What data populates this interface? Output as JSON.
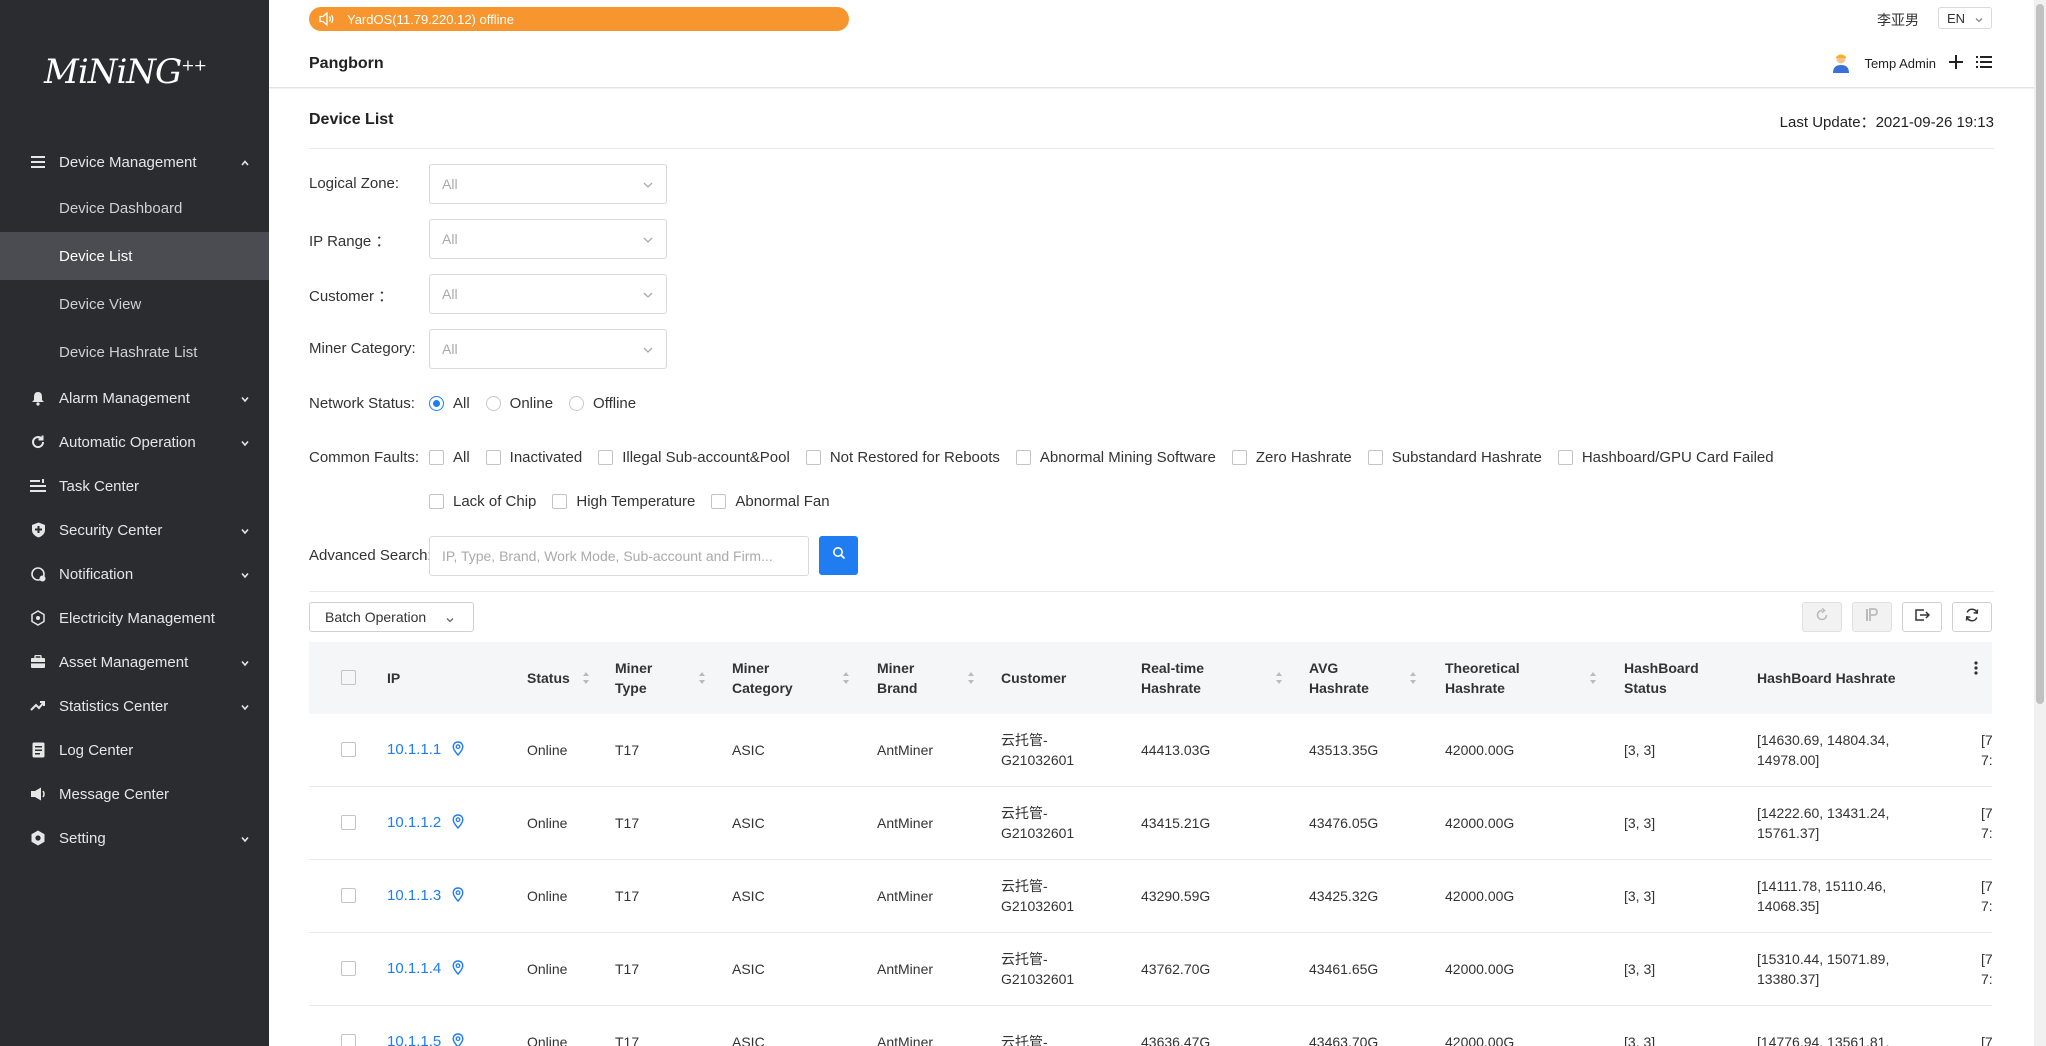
{
  "brand": {
    "logo_text": "MiNiNG",
    "logo_sup": "++"
  },
  "sidebar": {
    "items": [
      {
        "label": "Device Management",
        "icon": "list-icon",
        "expanded": true,
        "children": [
          {
            "label": "Device Dashboard"
          },
          {
            "label": "Device List",
            "active": true
          },
          {
            "label": "Device View"
          },
          {
            "label": "Device Hashrate List"
          }
        ]
      },
      {
        "label": "Alarm Management",
        "icon": "bell-icon",
        "has_arrow": true
      },
      {
        "label": "Automatic Operation",
        "icon": "sync-icon",
        "has_arrow": true
      },
      {
        "label": "Task Center",
        "icon": "task-list-icon",
        "has_arrow": false
      },
      {
        "label": "Security Center",
        "icon": "shield-icon",
        "has_arrow": true
      },
      {
        "label": "Notification",
        "icon": "notification-icon",
        "has_arrow": true
      },
      {
        "label": "Electricity Management",
        "icon": "electricity-icon",
        "has_arrow": false
      },
      {
        "label": "Asset Management",
        "icon": "asset-icon",
        "has_arrow": true
      },
      {
        "label": "Statistics Center",
        "icon": "trend-icon",
        "has_arrow": true
      },
      {
        "label": "Log Center",
        "icon": "document-icon",
        "has_arrow": false
      },
      {
        "label": "Message Center",
        "icon": "megaphone-icon",
        "has_arrow": false
      },
      {
        "label": "Setting",
        "icon": "gear-icon",
        "has_arrow": true
      }
    ]
  },
  "header": {
    "notice": "YardOS(11.79.220.12) offline",
    "user_name": "李亚男",
    "language": "EN",
    "site_name": "Pangborn",
    "admin_name": "Temp Admin"
  },
  "main": {
    "title": "Device List",
    "last_update_label": "Last Update：",
    "last_update_value": "2021-09-26 19:13",
    "filters": {
      "logical_zone": {
        "label": "Logical Zone:",
        "placeholder": "All"
      },
      "ip_range": {
        "label": "IP Range ：",
        "placeholder": "All"
      },
      "customer": {
        "label": "Customer ：",
        "placeholder": "All"
      },
      "miner_category": {
        "label": "Miner Category:",
        "placeholder": "All"
      },
      "network_status": {
        "label": "Network Status:",
        "options": [
          "All",
          "Online",
          "Offline"
        ],
        "selected": "All"
      },
      "common_faults": {
        "label": "Common Faults:",
        "row1": [
          "All",
          "Inactivated",
          "Illegal Sub-account&Pool",
          "Not Restored for Reboots",
          "Abnormal Mining Software",
          "Zero Hashrate",
          "Substandard Hashrate",
          "Hashboard/GPU Card Failed"
        ],
        "row2": [
          "Lack of Chip",
          "High Temperature",
          "Abnormal Fan"
        ]
      },
      "advanced_search": {
        "label": "Advanced Search:",
        "placeholder": "IP, Type, Brand, Work Mode, Sub-account and Firm..."
      }
    },
    "batch_operation_label": "Batch Operation",
    "table": {
      "columns": [
        "IP",
        "Status",
        "Miner\nType",
        "Miner\nCategory",
        "Miner\nBrand",
        "Customer",
        "Real-time\nHashrate",
        "AVG\nHashrate",
        "Theoretical\nHashrate",
        "HashBoard\nStatus",
        "HashBoard Hashrate"
      ],
      "rows": [
        {
          "ip": "10.1.1.1",
          "status": "Online",
          "type": "T17",
          "category": "ASIC",
          "brand": "AntMiner",
          "customer": "云托管-\nG21032601",
          "realtime": "44413.03G",
          "avg": "43513.35G",
          "theoretical": "42000.00G",
          "hb_status": "[3, 3]",
          "hb_hashrate": "[14630.69, 14804.34,\n14978.00]",
          "extra": "[7\n7:"
        },
        {
          "ip": "10.1.1.2",
          "status": "Online",
          "type": "T17",
          "category": "ASIC",
          "brand": "AntMiner",
          "customer": "云托管-\nG21032601",
          "realtime": "43415.21G",
          "avg": "43476.05G",
          "theoretical": "42000.00G",
          "hb_status": "[3, 3]",
          "hb_hashrate": "[14222.60, 13431.24,\n15761.37]",
          "extra": "[7\n7:"
        },
        {
          "ip": "10.1.1.3",
          "status": "Online",
          "type": "T17",
          "category": "ASIC",
          "brand": "AntMiner",
          "customer": "云托管-\nG21032601",
          "realtime": "43290.59G",
          "avg": "43425.32G",
          "theoretical": "42000.00G",
          "hb_status": "[3, 3]",
          "hb_hashrate": "[14111.78, 15110.46,\n14068.35]",
          "extra": "[7\n7:"
        },
        {
          "ip": "10.1.1.4",
          "status": "Online",
          "type": "T17",
          "category": "ASIC",
          "brand": "AntMiner",
          "customer": "云托管-\nG21032601",
          "realtime": "43762.70G",
          "avg": "43461.65G",
          "theoretical": "42000.00G",
          "hb_status": "[3, 3]",
          "hb_hashrate": "[15310.44, 15071.89,\n13380.37]",
          "extra": "[7\n7:"
        },
        {
          "ip": "10.1.1.5",
          "status": "Online",
          "type": "T17",
          "category": "ASIC",
          "brand": "AntMiner",
          "customer": "云托管-",
          "realtime": "43636.47G",
          "avg": "43463.70G",
          "theoretical": "42000.00G",
          "hb_status": "[3, 3]",
          "hb_hashrate": "[14776.94, 13561.81,",
          "extra": "[7"
        }
      ]
    }
  },
  "colors": {
    "accent": "#1f7cf1",
    "sidebar_bg": "#2a2c30",
    "notice_bg": "#f7962e"
  }
}
